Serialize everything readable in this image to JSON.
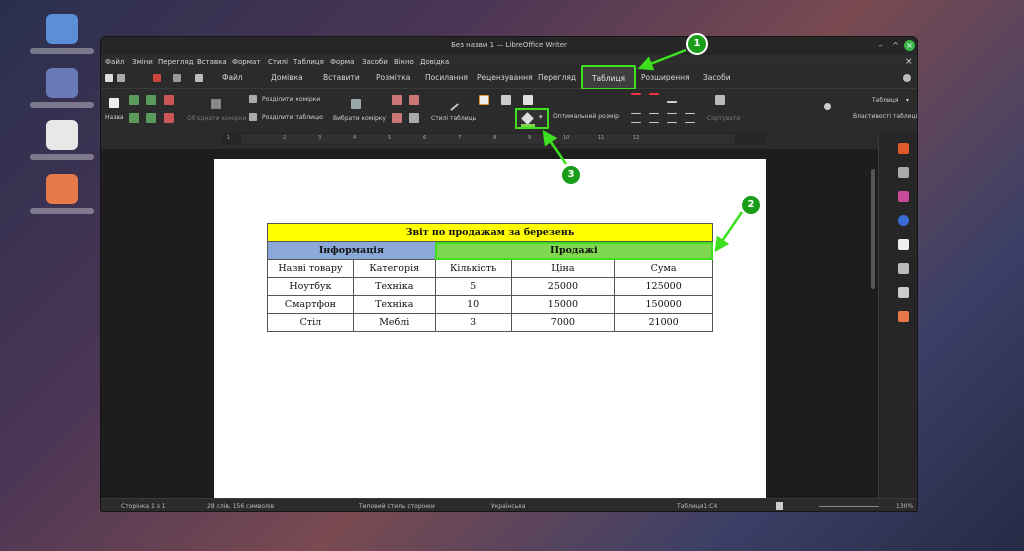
{
  "window": {
    "title": "Без назви 1 — LibreOffice Writer"
  },
  "menu": [
    "Файл",
    "Зміни",
    "Перегляд",
    "Вставка",
    "Формат",
    "Стилі",
    "Таблиця",
    "Форма",
    "Засоби",
    "Вікно",
    "Довідка"
  ],
  "tabs": [
    "Файл",
    "Домівка",
    "Вставити",
    "Розмітка",
    "Посилання",
    "Рецензування",
    "Перегляд",
    "Таблиця",
    "Розширення",
    "Засоби"
  ],
  "ribbon": {
    "name_label": "Назва",
    "merge_cells": "Об'єднати комірки",
    "split_cells": "Розділити комірки",
    "split_table": "Розділити таблицю",
    "select_cell": "Вибрати комірку",
    "table_styles": "Стилі таблиць",
    "optimal_size": "Оптимальний розмір",
    "sort": "Сортувати",
    "right_dropdown": "Таблиця",
    "table_props": "Властивості таблиці"
  },
  "ruler": {
    "marks": [
      "1",
      "1",
      "2",
      "3",
      "4",
      "5",
      "6",
      "7",
      "8",
      "9",
      "10",
      "11",
      "12"
    ]
  },
  "table": {
    "title": "Звіт по продажам за березень",
    "group_info": "Інформація",
    "group_sales": "Продажі",
    "headers": [
      "Назві товару",
      "Категорія",
      "Кількість",
      "Ціна",
      "Сума"
    ],
    "rows": [
      [
        "Ноутбук",
        "Техніка",
        "5",
        "25000",
        "125000"
      ],
      [
        "Смартфон",
        "Техніка",
        "10",
        "15000",
        "150000"
      ],
      [
        "Стіл",
        "Меблі",
        "3",
        "7000",
        "21000"
      ]
    ]
  },
  "status": {
    "page": "Сторінка 1 з 1",
    "words": "28 слів, 156 символів",
    "page_style": "Типовий стиль сторінки",
    "language": "Українська",
    "cell": "Таблиця1:C4",
    "zoom": "130%"
  },
  "callouts": [
    "1",
    "2",
    "3"
  ],
  "colors": {
    "highlight": "#3ce01e",
    "title_fill": "#ffff00",
    "info_fill": "#8aa9d8",
    "sales_fill": "#80d850"
  }
}
